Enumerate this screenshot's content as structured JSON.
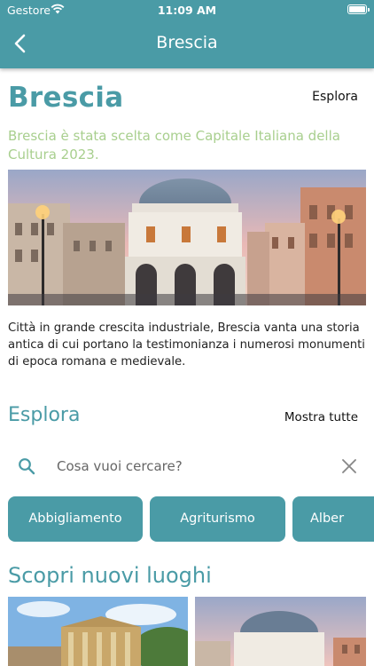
{
  "status_bar": {
    "carrier": "Gestore",
    "time": "11:09 AM"
  },
  "nav": {
    "title": "Brescia",
    "back_icon": "chevron-left-icon"
  },
  "page": {
    "title": "Brescia",
    "explore_link": "Esplora",
    "subtitle": "Brescia è stata scelta come Capitale Italiana della Cultura 2023.",
    "description": "Città in grande crescita industriale, Brescia vanta una storia antica di cui portano la testimonianza i numerosi monumenti di epoca romana e medievale."
  },
  "explore": {
    "title": "Esplora",
    "show_all": "Mostra tutte",
    "search_placeholder": "Cosa vuoi cercare?",
    "categories": [
      "Abbigliamento",
      "Agriturismo",
      "Alber"
    ]
  },
  "discover": {
    "title": "Scopri nuovi luoghi"
  },
  "colors": {
    "primary": "#4a9ba6",
    "subtitle": "#a8cf8e"
  }
}
